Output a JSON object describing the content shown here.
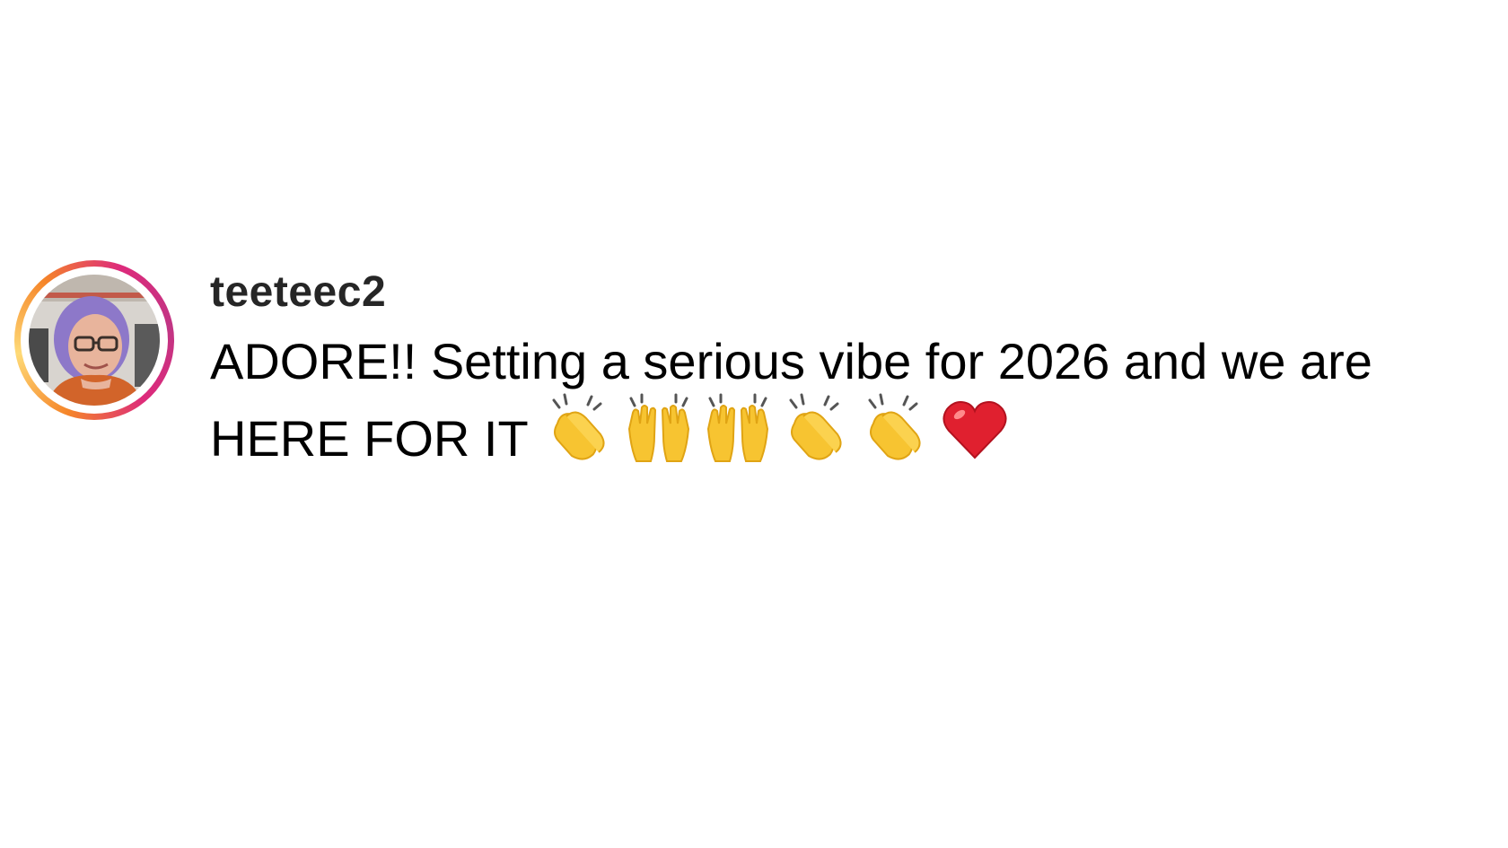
{
  "comment": {
    "username": "teeteec2",
    "text_line_1": "ADORE!! Setting a serious vibe for 2026 and we are",
    "text_line_2": "HERE FOR IT",
    "emojis": [
      {
        "icon": "clapping-hands-icon",
        "char": "👏"
      },
      {
        "icon": "raising-hands-icon",
        "char": "🙌"
      },
      {
        "icon": "raising-hands-icon",
        "char": "🙌"
      },
      {
        "icon": "clapping-hands-icon",
        "char": "👏"
      },
      {
        "icon": "clapping-hands-icon",
        "char": "👏"
      },
      {
        "icon": "red-heart-icon",
        "char": "❤️"
      }
    ]
  },
  "colors": {
    "story_ring_gradient": [
      "#f58529",
      "#feda77",
      "#dd2a7b",
      "#c13584"
    ],
    "username": "#262626",
    "text": "#000000",
    "emoji_skin": "#f7c431",
    "heart": "#e0202f"
  }
}
